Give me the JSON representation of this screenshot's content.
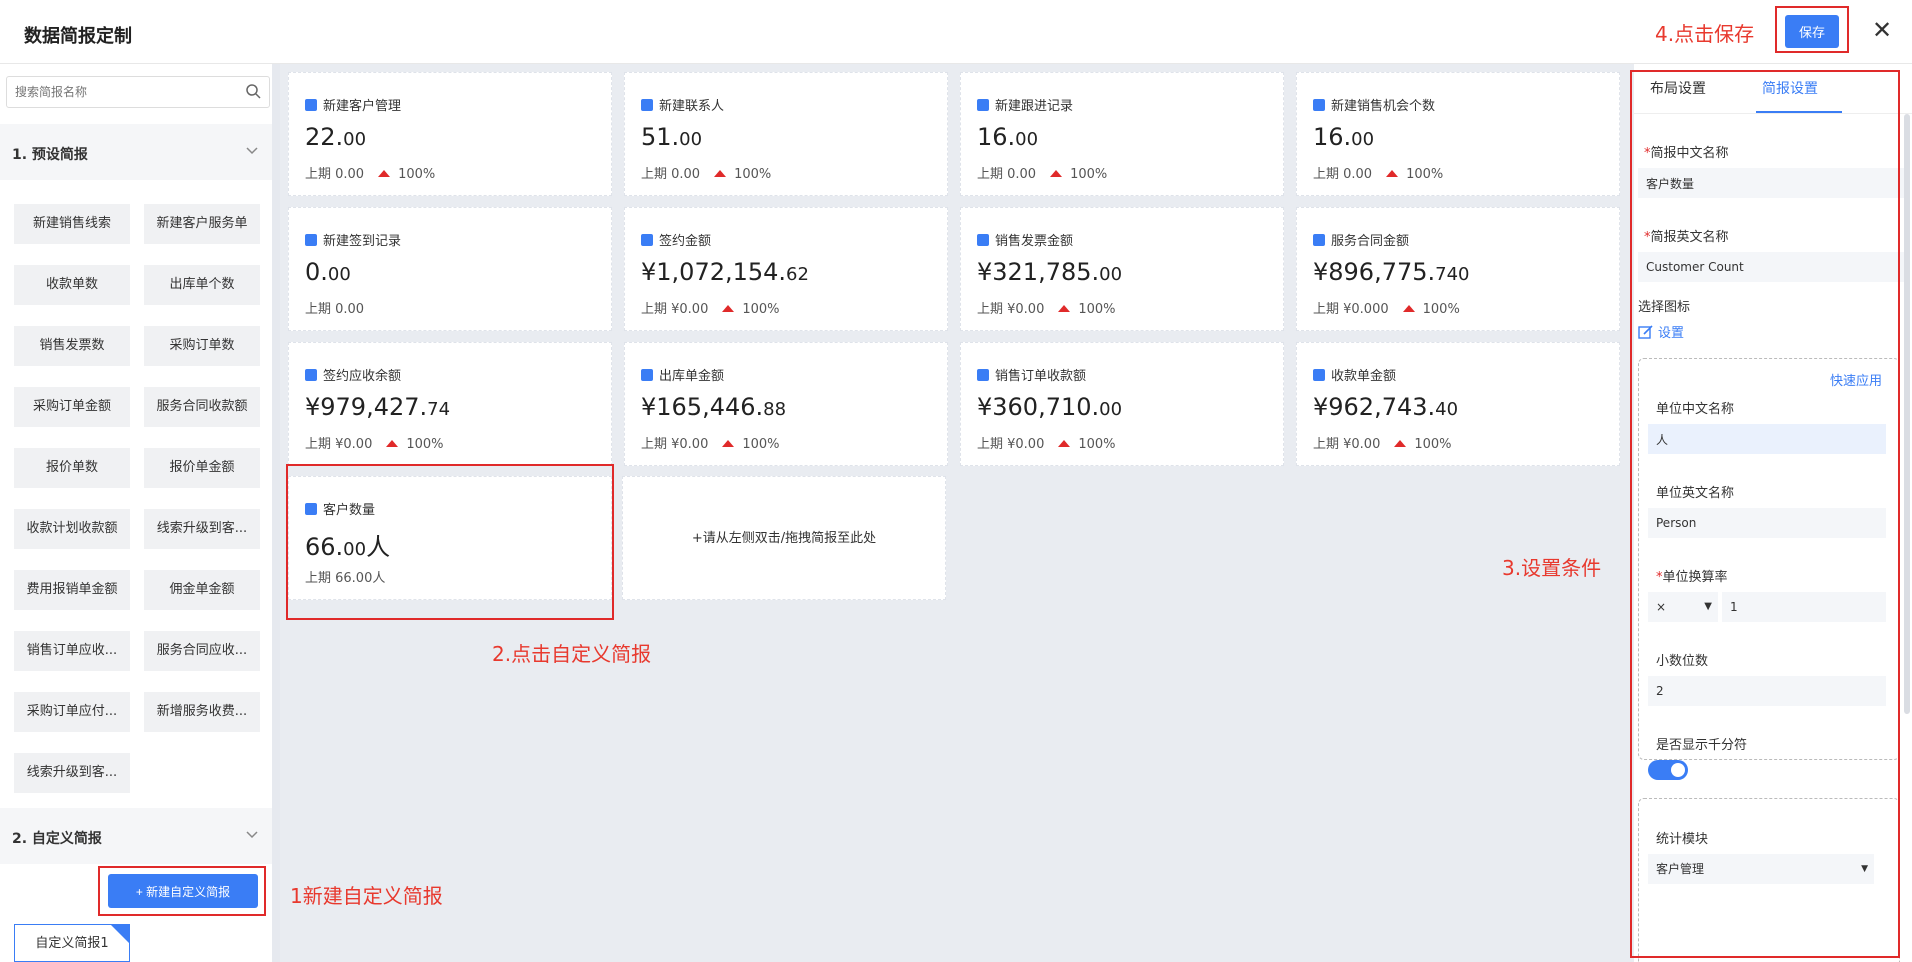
{
  "header": {
    "title": "数据简报定制",
    "save_label": "保存",
    "close_glyph": "✕",
    "step4": "4.点击保存"
  },
  "annotations": {
    "step1": "1新建自定义简报",
    "step2": "2.点击自定义简报",
    "step3": "3.设置条件"
  },
  "left": {
    "search_placeholder": "搜索简报名称",
    "section1": "1. 预设简报",
    "preset_items": [
      "新建销售线索",
      "新建客户服务单",
      "收款单数",
      "出库单个数",
      "销售发票数",
      "采购订单数",
      "采购订单金额",
      "服务合同收款额",
      "报价单数",
      "报价单金额",
      "收款计划收款额",
      "线索升级到客...",
      "费用报销单金额",
      "佣金单金额",
      "销售订单应收...",
      "服务合同应收...",
      "采购订单应付...",
      "新增服务收费...",
      "线索升级到客..."
    ],
    "section2": "2. 自定义简报",
    "new_custom_label": "+ 新建自定义简报",
    "custom_item": "自定义简报1"
  },
  "cards": [
    {
      "title": "新建客户管理",
      "int": "22.",
      "dec": "00",
      "prev": "上期  0.00",
      "pct": "100%",
      "icon": "user-icon"
    },
    {
      "title": "新建联系人",
      "int": "51.",
      "dec": "00",
      "prev": "上期  0.00",
      "pct": "100%",
      "icon": "contact-icon"
    },
    {
      "title": "新建跟进记录",
      "int": "16.",
      "dec": "00",
      "prev": "上期  0.00",
      "pct": "100%",
      "icon": "doc-icon"
    },
    {
      "title": "新建销售机会个数",
      "int": "16.",
      "dec": "00",
      "prev": "上期  0.00",
      "pct": "100%",
      "icon": "target-icon"
    },
    {
      "title": "新建签到记录",
      "int": "0.",
      "dec": "00",
      "prev": "上期  0.00",
      "pct": "",
      "icon": "doc-icon"
    },
    {
      "title": "签约金额",
      "int": "¥1,072,154.",
      "dec": "62",
      "prev": "上期  ¥0.00",
      "pct": "100%",
      "icon": "doc-icon"
    },
    {
      "title": "销售发票金额",
      "int": "¥321,785.",
      "dec": "00",
      "prev": "上期  ¥0.00",
      "pct": "100%",
      "icon": "invoice-icon"
    },
    {
      "title": "服务合同金额",
      "int": "¥896,775.",
      "dec": "740",
      "prev": "上期  ¥0.000",
      "pct": "100%",
      "icon": "home-icon"
    },
    {
      "title": "签约应收余额",
      "int": "¥979,427.",
      "dec": "74",
      "prev": "上期  ¥0.00",
      "pct": "100%",
      "icon": "doc-icon"
    },
    {
      "title": "出库单金额",
      "int": "¥165,446.",
      "dec": "88",
      "prev": "上期  ¥0.00",
      "pct": "100%",
      "icon": "home-icon"
    },
    {
      "title": "销售订单收款额",
      "int": "¥360,710.",
      "dec": "00",
      "prev": "上期  ¥0.00",
      "pct": "100%",
      "icon": "doc-icon"
    },
    {
      "title": "收款单金额",
      "int": "¥962,743.",
      "dec": "40",
      "prev": "上期  ¥0.00",
      "pct": "100%",
      "icon": "contact-icon"
    }
  ],
  "custom_card": {
    "title": "客户数量",
    "int": "66.",
    "dec": "00",
    "unit": "人",
    "prev": "上期  66.00人"
  },
  "drop_zone": "+请从左侧双击/拖拽简报至此处",
  "right": {
    "tab_layout": "布局设置",
    "tab_report": "简报设置",
    "cn_name_label": "简报中文名称",
    "cn_name_value": "客户数量",
    "en_name_label": "简报英文名称",
    "en_name_value": "Customer Count",
    "icon_label": "选择图标",
    "icon_set": "设置",
    "quick_apply": "快速应用",
    "unit_cn_label": "单位中文名称",
    "unit_cn_value": "人",
    "unit_en_label": "单位英文名称",
    "unit_en_value": "Person",
    "rate_label": "单位换算率",
    "rate_op": "×",
    "rate_value": "1",
    "decimal_label": "小数位数",
    "decimal_value": "2",
    "thousand_label": "是否显示千分符",
    "thousand_on": true,
    "module_label": "统计模块",
    "module_value": "客户管理"
  },
  "colors": {
    "accent": "#3a7df5",
    "annotation": "#e8392e",
    "up": "#e02a2a"
  }
}
